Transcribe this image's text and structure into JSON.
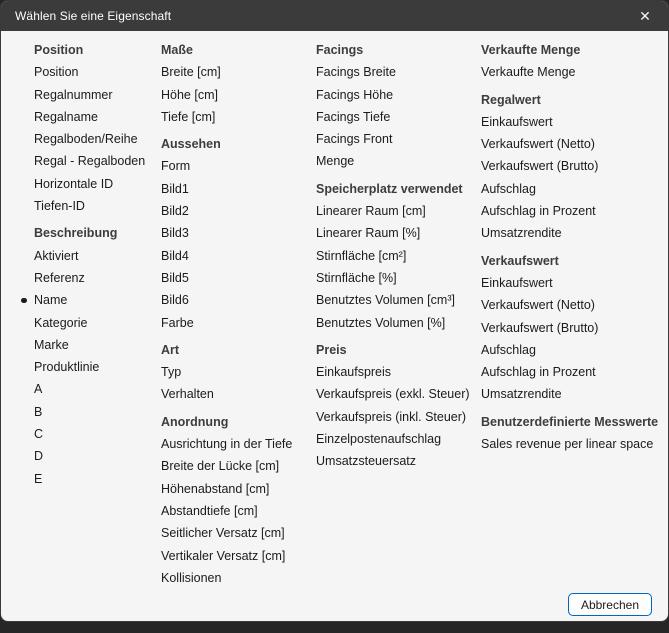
{
  "titlebar": {
    "title": "Wählen Sie eine Eigenschaft",
    "close_glyph": "✕"
  },
  "footer": {
    "cancel_label": "Abbrechen"
  },
  "colors": {
    "titlebar_bg": "#3b3b3b",
    "dialog_bg": "#f5f5f5",
    "accent_button_border": "#0067c0",
    "text": "#1b1b1b"
  },
  "columns": [
    {
      "groups": [
        {
          "header": "Position",
          "items": [
            {
              "label": "Position"
            },
            {
              "label": "Regalnummer"
            },
            {
              "label": "Regalname"
            },
            {
              "label": "Regalboden/Reihe"
            },
            {
              "label": "Regal - Regalboden"
            },
            {
              "label": "Horizontale ID"
            },
            {
              "label": "Tiefen-ID"
            }
          ]
        },
        {
          "header": "Beschreibung",
          "items": [
            {
              "label": "Aktiviert"
            },
            {
              "label": "Referenz"
            },
            {
              "label": "Name",
              "selected": true
            },
            {
              "label": "Kategorie"
            },
            {
              "label": "Marke"
            },
            {
              "label": "Produktlinie"
            },
            {
              "label": "A"
            },
            {
              "label": "B"
            },
            {
              "label": "C"
            },
            {
              "label": "D"
            },
            {
              "label": "E"
            }
          ]
        }
      ]
    },
    {
      "groups": [
        {
          "header": "Maße",
          "items": [
            {
              "label": "Breite [cm]"
            },
            {
              "label": "Höhe [cm]"
            },
            {
              "label": "Tiefe [cm]"
            }
          ]
        },
        {
          "header": "Aussehen",
          "items": [
            {
              "label": "Form"
            },
            {
              "label": "Bild1"
            },
            {
              "label": "Bild2"
            },
            {
              "label": "Bild3"
            },
            {
              "label": "Bild4"
            },
            {
              "label": "Bild5"
            },
            {
              "label": "Bild6"
            },
            {
              "label": "Farbe"
            }
          ]
        },
        {
          "header": "Art",
          "items": [
            {
              "label": "Typ"
            },
            {
              "label": "Verhalten"
            }
          ]
        },
        {
          "header": "Anordnung",
          "items": [
            {
              "label": "Ausrichtung in der Tiefe"
            },
            {
              "label": "Breite der Lücke [cm]"
            },
            {
              "label": "Höhenabstand [cm]"
            },
            {
              "label": "Abstandtiefe [cm]"
            },
            {
              "label": "Seitlicher Versatz [cm]"
            },
            {
              "label": "Vertikaler Versatz [cm]"
            },
            {
              "label": "Kollisionen"
            }
          ]
        }
      ]
    },
    {
      "groups": [
        {
          "header": "Facings",
          "items": [
            {
              "label": "Facings Breite"
            },
            {
              "label": "Facings Höhe"
            },
            {
              "label": "Facings Tiefe"
            },
            {
              "label": "Facings Front"
            },
            {
              "label": "Menge"
            }
          ]
        },
        {
          "header": "Speicherplatz verwendet",
          "items": [
            {
              "label": "Linearer Raum [cm]"
            },
            {
              "label": "Linearer Raum [%]"
            },
            {
              "label": "Stirnfläche [cm²]"
            },
            {
              "label": "Stirnfläche [%]"
            },
            {
              "label": "Benutztes Volumen [cm³]"
            },
            {
              "label": "Benutztes Volumen [%]"
            }
          ]
        },
        {
          "header": "Preis",
          "items": [
            {
              "label": "Einkaufspreis"
            },
            {
              "label": "Verkaufspreis (exkl. Steuer)"
            },
            {
              "label": "Verkaufspreis (inkl. Steuer)"
            },
            {
              "label": "Einzelpostenaufschlag"
            },
            {
              "label": "Umsatzsteuersatz"
            }
          ]
        }
      ]
    },
    {
      "groups": [
        {
          "header": "Verkaufte Menge",
          "items": [
            {
              "label": "Verkaufte Menge"
            }
          ]
        },
        {
          "header": "Regalwert",
          "items": [
            {
              "label": "Einkaufswert"
            },
            {
              "label": "Verkaufswert (Netto)"
            },
            {
              "label": "Verkaufswert (Brutto)"
            },
            {
              "label": "Aufschlag"
            },
            {
              "label": "Aufschlag in Prozent"
            },
            {
              "label": "Umsatzrendite"
            }
          ]
        },
        {
          "header": "Verkaufswert",
          "items": [
            {
              "label": "Einkaufswert"
            },
            {
              "label": "Verkaufswert (Netto)"
            },
            {
              "label": "Verkaufswert (Brutto)"
            },
            {
              "label": "Aufschlag"
            },
            {
              "label": "Aufschlag in Prozent"
            },
            {
              "label": "Umsatzrendite"
            }
          ]
        },
        {
          "header": "Benutzerdefinierte Messwerte",
          "items": [
            {
              "label": "Sales revenue per linear space"
            }
          ]
        }
      ]
    }
  ]
}
